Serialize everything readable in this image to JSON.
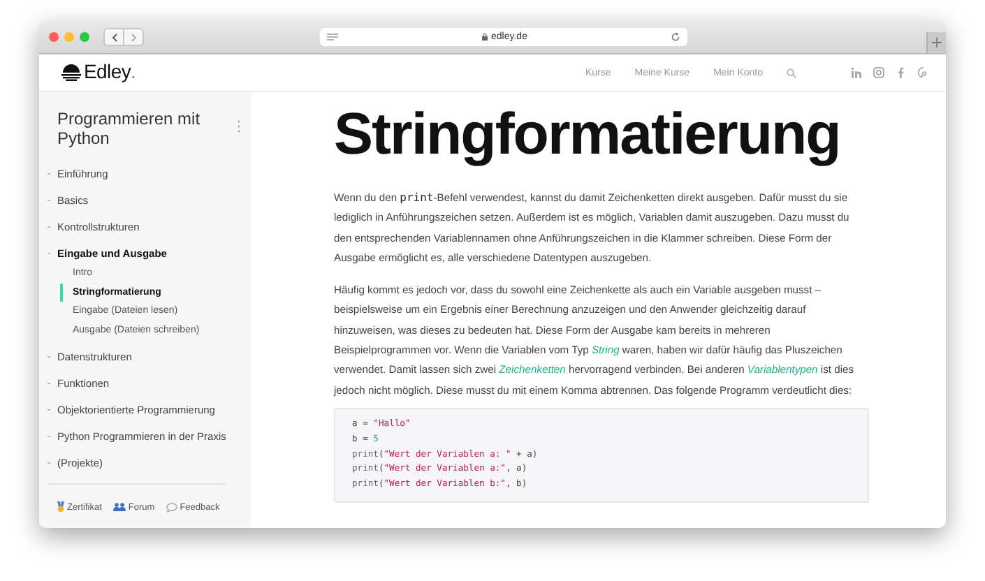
{
  "browser": {
    "address": "edley.de"
  },
  "header": {
    "logo": {
      "name": "Edley",
      "dot": "."
    },
    "nav": [
      "Kurse",
      "Meine Kurse",
      "Mein Konto"
    ]
  },
  "sidebar": {
    "title": "Programmieren mit Python",
    "items": [
      {
        "label": "Einführung",
        "expanded": false
      },
      {
        "label": "Basics",
        "expanded": false
      },
      {
        "label": "Kontrollstrukturen",
        "expanded": false
      },
      {
        "label": "Eingabe und Ausgabe",
        "expanded": true,
        "children": [
          {
            "label": "Intro",
            "selected": false
          },
          {
            "label": "Stringformatierung",
            "selected": true
          },
          {
            "label": "Eingabe (Dateien lesen)",
            "selected": false
          },
          {
            "label": "Ausgabe (Dateien schreiben)",
            "selected": false
          }
        ]
      },
      {
        "label": "Datenstrukturen",
        "expanded": false
      },
      {
        "label": "Funktionen",
        "expanded": false
      },
      {
        "label": "Objektorientierte Programmierung",
        "expanded": false
      },
      {
        "label": "Python Programmieren in der Praxis",
        "expanded": false
      },
      {
        "label": "(Projekte)",
        "expanded": false
      }
    ],
    "footer": [
      {
        "kind": "certificate",
        "label": "Zertifikat"
      },
      {
        "kind": "forum",
        "label": "Forum"
      },
      {
        "kind": "feedback",
        "label": "Feedback"
      }
    ]
  },
  "article": {
    "title": "Stringformatierung",
    "paragraphs": [
      [
        {
          "kind": "text",
          "text": "Wenn du den "
        },
        {
          "kind": "code",
          "text": "print"
        },
        {
          "kind": "text",
          "text": "-Befehl verwendest, kannst du damit Zeichenketten direkt ausgeben. Dafür musst du sie lediglich in Anführungszeichen setzen. Außerdem ist es möglich, Variablen damit auszugeben. Dazu musst du den entsprechenden Variablennamen ohne Anführungszeichen in die Klammer schreiben. Diese Form der Ausgabe ermöglicht es, alle verschiedene Datentypen auszugeben."
        }
      ],
      [
        {
          "kind": "text",
          "text": "Häufig kommt es jedoch vor, dass du sowohl eine Zeichenkette als auch ein Variable ausgeben musst – beispielsweise um ein Ergebnis einer Berechnung anzuzeigen und den Anwender gleichzeitig darauf hinzuweisen, was dieses zu bedeuten hat. Diese Form der Ausgabe kam bereits in mehreren Beispielprogrammen vor. Wenn die Variablen vom Typ "
        },
        {
          "kind": "link",
          "text": "String"
        },
        {
          "kind": "text",
          "text": " waren, haben wir dafür häufig das Pluszeichen verwendet. Damit lassen sich zwei "
        },
        {
          "kind": "link",
          "text": "Zeichenketten"
        },
        {
          "kind": "text",
          "text": " hervorragend verbinden. Bei anderen "
        },
        {
          "kind": "link",
          "text": "Variablentypen"
        },
        {
          "kind": "text",
          "text": " ist dies jedoch nicht möglich. Diese musst du mit einem Komma abtrennen. Das folgende Programm verdeutlicht dies:"
        }
      ]
    ],
    "code": [
      [
        {
          "kind": "plain",
          "text": "a = "
        },
        {
          "kind": "string",
          "text": "\"Hallo\""
        }
      ],
      [
        {
          "kind": "plain",
          "text": "b = "
        },
        {
          "kind": "number",
          "text": "5"
        }
      ],
      [
        {
          "kind": "builtin",
          "text": "print"
        },
        {
          "kind": "plain",
          "text": "("
        },
        {
          "kind": "string",
          "text": "\"Wert der Variablen a: \""
        },
        {
          "kind": "plain",
          "text": " + a)"
        }
      ],
      [
        {
          "kind": "builtin",
          "text": "print"
        },
        {
          "kind": "plain",
          "text": "("
        },
        {
          "kind": "string",
          "text": "\"Wert der Variablen a:\""
        },
        {
          "kind": "plain",
          "text": ", a)"
        }
      ],
      [
        {
          "kind": "builtin",
          "text": "print"
        },
        {
          "kind": "plain",
          "text": "("
        },
        {
          "kind": "string",
          "text": "\"Wert der Variablen b:\""
        },
        {
          "kind": "plain",
          "text": ", b)"
        }
      ]
    ]
  }
}
